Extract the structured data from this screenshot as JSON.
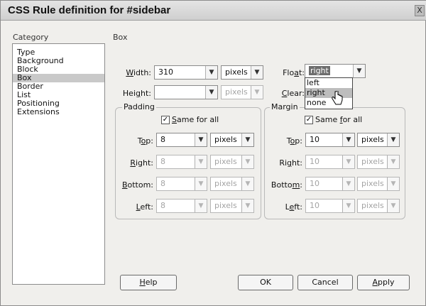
{
  "window": {
    "title": "CSS Rule definition for #sidebar",
    "close_glyph": "X"
  },
  "category_header": "Category",
  "box_header": "Box",
  "categories": [
    "Type",
    "Background",
    "Block",
    "Box",
    "Border",
    "List",
    "Positioning",
    "Extensions"
  ],
  "selected_category": "Box",
  "width": {
    "label_pre": "",
    "label_u": "W",
    "label_post": "idth:",
    "value": "310",
    "unit": "pixels"
  },
  "height": {
    "label_pre": "Hei",
    "label_u": "g",
    "label_post": "ht:",
    "value": "",
    "unit": "pixels"
  },
  "float": {
    "label_pre": "Flo",
    "label_u": "a",
    "label_post": "t:",
    "value": "right",
    "options": [
      "left",
      "right",
      "none"
    ],
    "highlighted": "right"
  },
  "clear": {
    "label_pre": "",
    "label_u": "C",
    "label_post": "lear:"
  },
  "padding": {
    "legend": "Padding",
    "same_for_all": {
      "pre": "",
      "u": "S",
      "post": "ame for all",
      "checked": "✓"
    },
    "top": {
      "pre": "T",
      "u": "o",
      "post": "p:",
      "value": "8",
      "unit": "pixels"
    },
    "right": {
      "pre": "",
      "u": "R",
      "post": "ight:",
      "value": "8",
      "unit": "pixels"
    },
    "bottom": {
      "pre": "",
      "u": "B",
      "post": "ottom:",
      "value": "8",
      "unit": "pixels"
    },
    "left": {
      "pre": "",
      "u": "L",
      "post": "eft:",
      "value": "8",
      "unit": "pixels"
    }
  },
  "margin": {
    "legend": "Margin",
    "same_for_all": {
      "pre": "Same ",
      "u": "f",
      "post": "or all",
      "checked": "✓"
    },
    "top": {
      "pre": "T",
      "u": "o",
      "post": "p:",
      "value": "10",
      "unit": "pixels"
    },
    "right": {
      "pre": "Ri",
      "u": "g",
      "post": "ht:",
      "value": "10",
      "unit": "pixels"
    },
    "bottom": {
      "pre": "Botto",
      "u": "m",
      "post": ":",
      "value": "10",
      "unit": "pixels"
    },
    "left": {
      "pre": "L",
      "u": "e",
      "post": "ft:",
      "value": "10",
      "unit": "pixels"
    }
  },
  "buttons": {
    "help": {
      "pre": "",
      "u": "H",
      "post": "elp"
    },
    "ok": "OK",
    "cancel": "Cancel",
    "apply": {
      "pre": "",
      "u": "A",
      "post": "pply"
    }
  },
  "arrow_glyph": "▼"
}
